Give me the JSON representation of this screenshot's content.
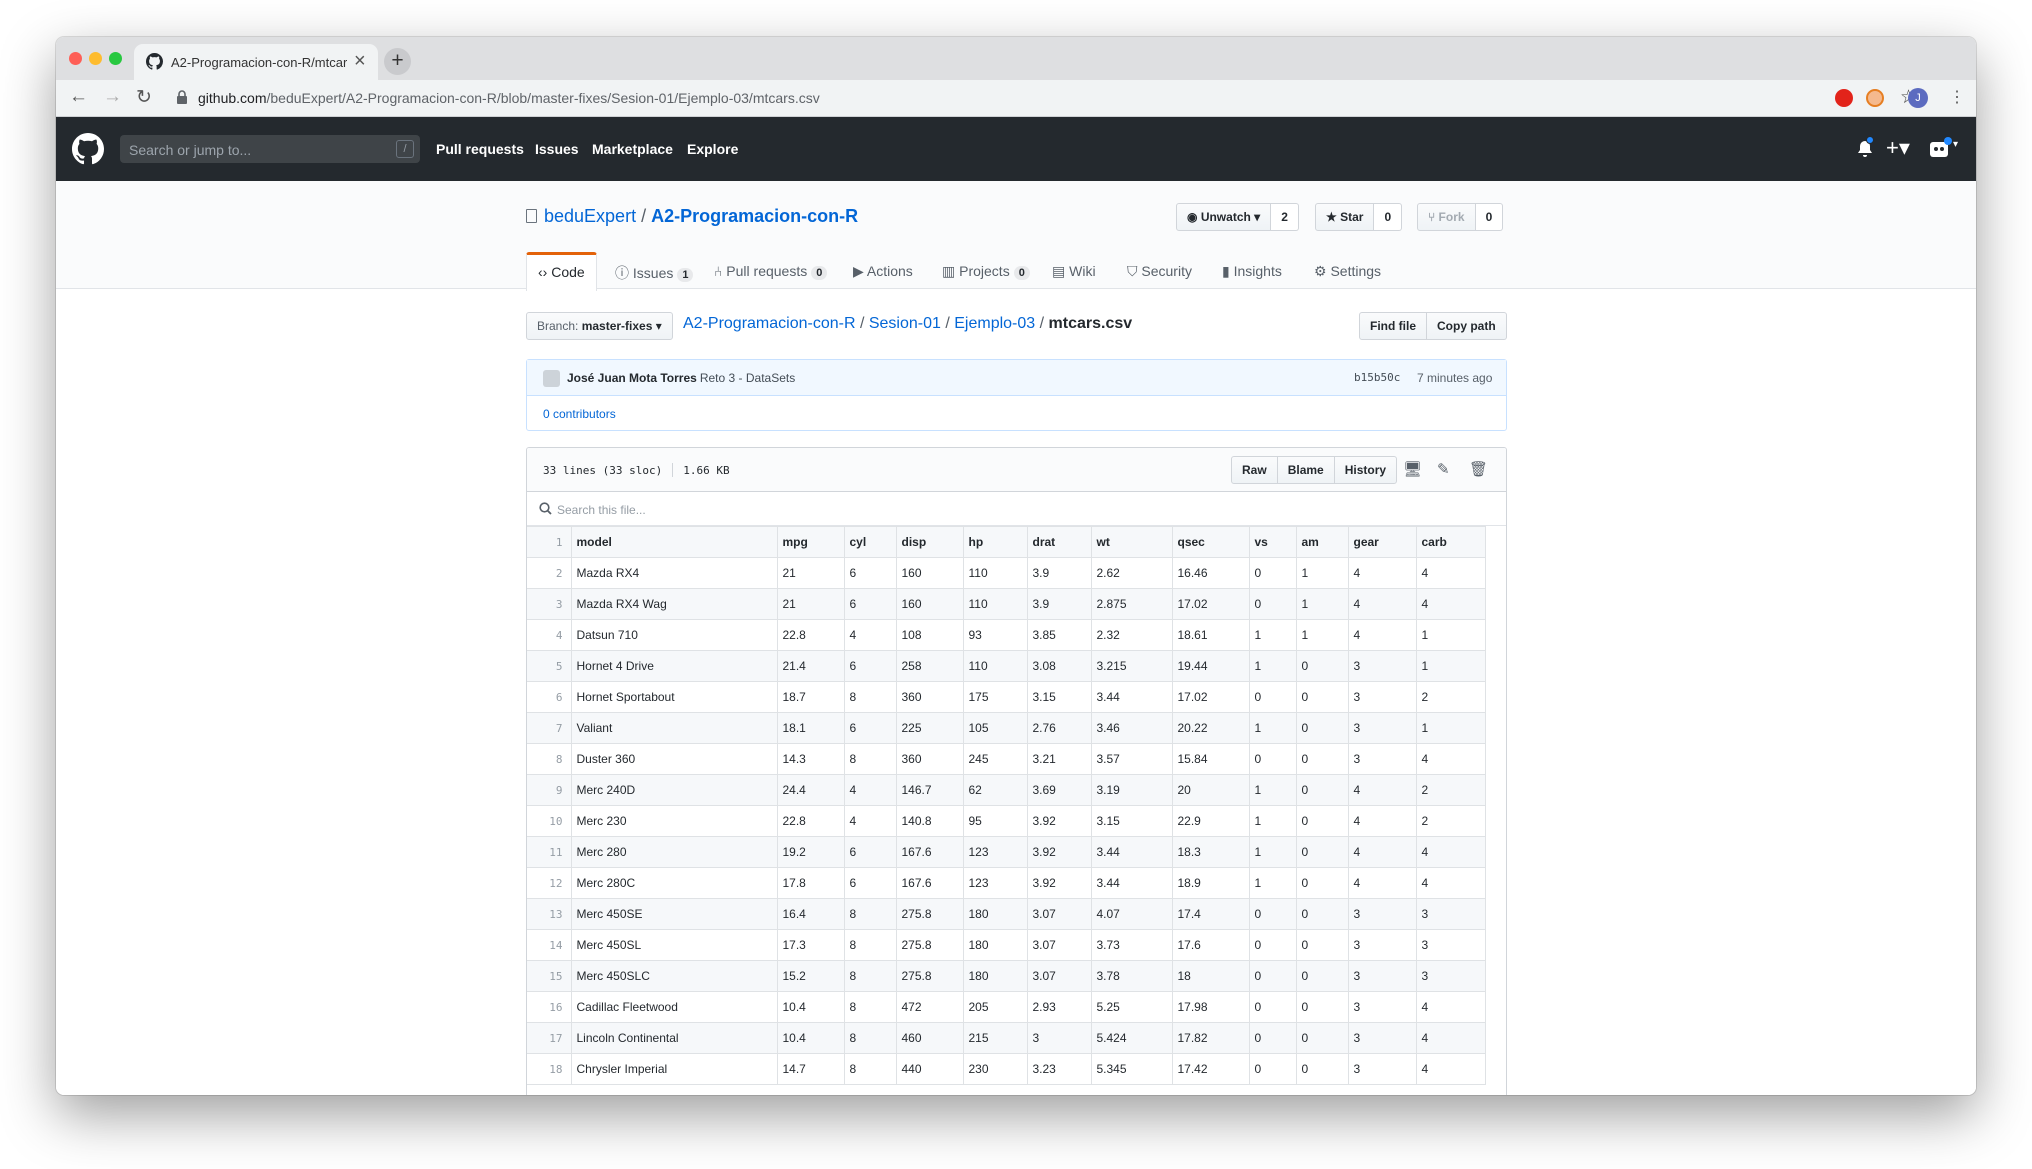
{
  "browser": {
    "tab_title": "A2-Programacion-con-R/mtcars",
    "url_domain": "github.com",
    "url_path": "/beduExpert/A2-Programacion-con-R/blob/master-fixes/Sesion-01/Ejemplo-03/mtcars.csv",
    "profile_initial": "J"
  },
  "header": {
    "search_placeholder": "Search or jump to...",
    "search_hotkey": "/",
    "nav": [
      "Pull requests",
      "Issues",
      "Marketplace",
      "Explore"
    ]
  },
  "repo": {
    "owner": "beduExpert",
    "separator": "/",
    "name": "A2-Programacion-con-R",
    "watch_label": "Unwatch",
    "watch_count": "2",
    "star_label": "Star",
    "star_count": "0",
    "fork_label": "Fork",
    "fork_count": "0",
    "tabs": {
      "code": "Code",
      "issues": "Issues",
      "issues_count": "1",
      "pulls": "Pull requests",
      "pulls_count": "0",
      "actions": "Actions",
      "projects": "Projects",
      "projects_count": "0",
      "wiki": "Wiki",
      "security": "Security",
      "insights": "Insights",
      "settings": "Settings"
    }
  },
  "file": {
    "branch_label": "Branch:",
    "branch_name": "master-fixes",
    "crumbs": [
      "A2-Programacion-con-R",
      "Sesion-01",
      "Ejemplo-03"
    ],
    "filename": "mtcars.csv",
    "find_file": "Find file",
    "copy_path": "Copy path",
    "commit_author": "José Juan Mota Torres",
    "commit_message": "Reto 3 - DataSets",
    "commit_sha": "b15b50c",
    "commit_time": "7 minutes ago",
    "contributors": "0 contributors",
    "lines_info": "33 lines (33 sloc)",
    "size_info": "1.66 KB",
    "raw": "Raw",
    "blame": "Blame",
    "history": "History",
    "search_placeholder": "Search this file..."
  },
  "csv": {
    "headers": [
      "model",
      "mpg",
      "cyl",
      "disp",
      "hp",
      "drat",
      "wt",
      "qsec",
      "vs",
      "am",
      "gear",
      "carb"
    ],
    "rows": [
      [
        "Mazda RX4",
        "21",
        "6",
        "160",
        "110",
        "3.9",
        "2.62",
        "16.46",
        "0",
        "1",
        "4",
        "4"
      ],
      [
        "Mazda RX4 Wag",
        "21",
        "6",
        "160",
        "110",
        "3.9",
        "2.875",
        "17.02",
        "0",
        "1",
        "4",
        "4"
      ],
      [
        "Datsun 710",
        "22.8",
        "4",
        "108",
        "93",
        "3.85",
        "2.32",
        "18.61",
        "1",
        "1",
        "4",
        "1"
      ],
      [
        "Hornet 4 Drive",
        "21.4",
        "6",
        "258",
        "110",
        "3.08",
        "3.215",
        "19.44",
        "1",
        "0",
        "3",
        "1"
      ],
      [
        "Hornet Sportabout",
        "18.7",
        "8",
        "360",
        "175",
        "3.15",
        "3.44",
        "17.02",
        "0",
        "0",
        "3",
        "2"
      ],
      [
        "Valiant",
        "18.1",
        "6",
        "225",
        "105",
        "2.76",
        "3.46",
        "20.22",
        "1",
        "0",
        "3",
        "1"
      ],
      [
        "Duster 360",
        "14.3",
        "8",
        "360",
        "245",
        "3.21",
        "3.57",
        "15.84",
        "0",
        "0",
        "3",
        "4"
      ],
      [
        "Merc 240D",
        "24.4",
        "4",
        "146.7",
        "62",
        "3.69",
        "3.19",
        "20",
        "1",
        "0",
        "4",
        "2"
      ],
      [
        "Merc 230",
        "22.8",
        "4",
        "140.8",
        "95",
        "3.92",
        "3.15",
        "22.9",
        "1",
        "0",
        "4",
        "2"
      ],
      [
        "Merc 280",
        "19.2",
        "6",
        "167.6",
        "123",
        "3.92",
        "3.44",
        "18.3",
        "1",
        "0",
        "4",
        "4"
      ],
      [
        "Merc 280C",
        "17.8",
        "6",
        "167.6",
        "123",
        "3.92",
        "3.44",
        "18.9",
        "1",
        "0",
        "4",
        "4"
      ],
      [
        "Merc 450SE",
        "16.4",
        "8",
        "275.8",
        "180",
        "3.07",
        "4.07",
        "17.4",
        "0",
        "0",
        "3",
        "3"
      ],
      [
        "Merc 450SL",
        "17.3",
        "8",
        "275.8",
        "180",
        "3.07",
        "3.73",
        "17.6",
        "0",
        "0",
        "3",
        "3"
      ],
      [
        "Merc 450SLC",
        "15.2",
        "8",
        "275.8",
        "180",
        "3.07",
        "3.78",
        "18",
        "0",
        "0",
        "3",
        "3"
      ],
      [
        "Cadillac Fleetwood",
        "10.4",
        "8",
        "472",
        "205",
        "2.93",
        "5.25",
        "17.98",
        "0",
        "0",
        "3",
        "4"
      ],
      [
        "Lincoln Continental",
        "10.4",
        "8",
        "460",
        "215",
        "3",
        "5.424",
        "17.82",
        "0",
        "0",
        "3",
        "4"
      ],
      [
        "Chrysler Imperial",
        "14.7",
        "8",
        "440",
        "230",
        "3.23",
        "5.345",
        "17.42",
        "0",
        "0",
        "3",
        "4"
      ]
    ]
  },
  "colors": {
    "header_bg": "#24292e",
    "link": "#0366d6",
    "tab_accent": "#e36209",
    "commit_bg": "#f1f8ff"
  },
  "icons": [
    "github-mark-icon",
    "book-icon",
    "eye-icon",
    "star-icon",
    "fork-icon",
    "code-icon",
    "issue-icon",
    "pr-icon",
    "play-icon",
    "project-icon",
    "wiki-icon",
    "shield-icon",
    "graph-icon",
    "gear-icon",
    "bell-icon",
    "plus-icon",
    "avatar-icon",
    "desktop-icon",
    "pencil-icon",
    "trash-icon",
    "search-icon"
  ]
}
